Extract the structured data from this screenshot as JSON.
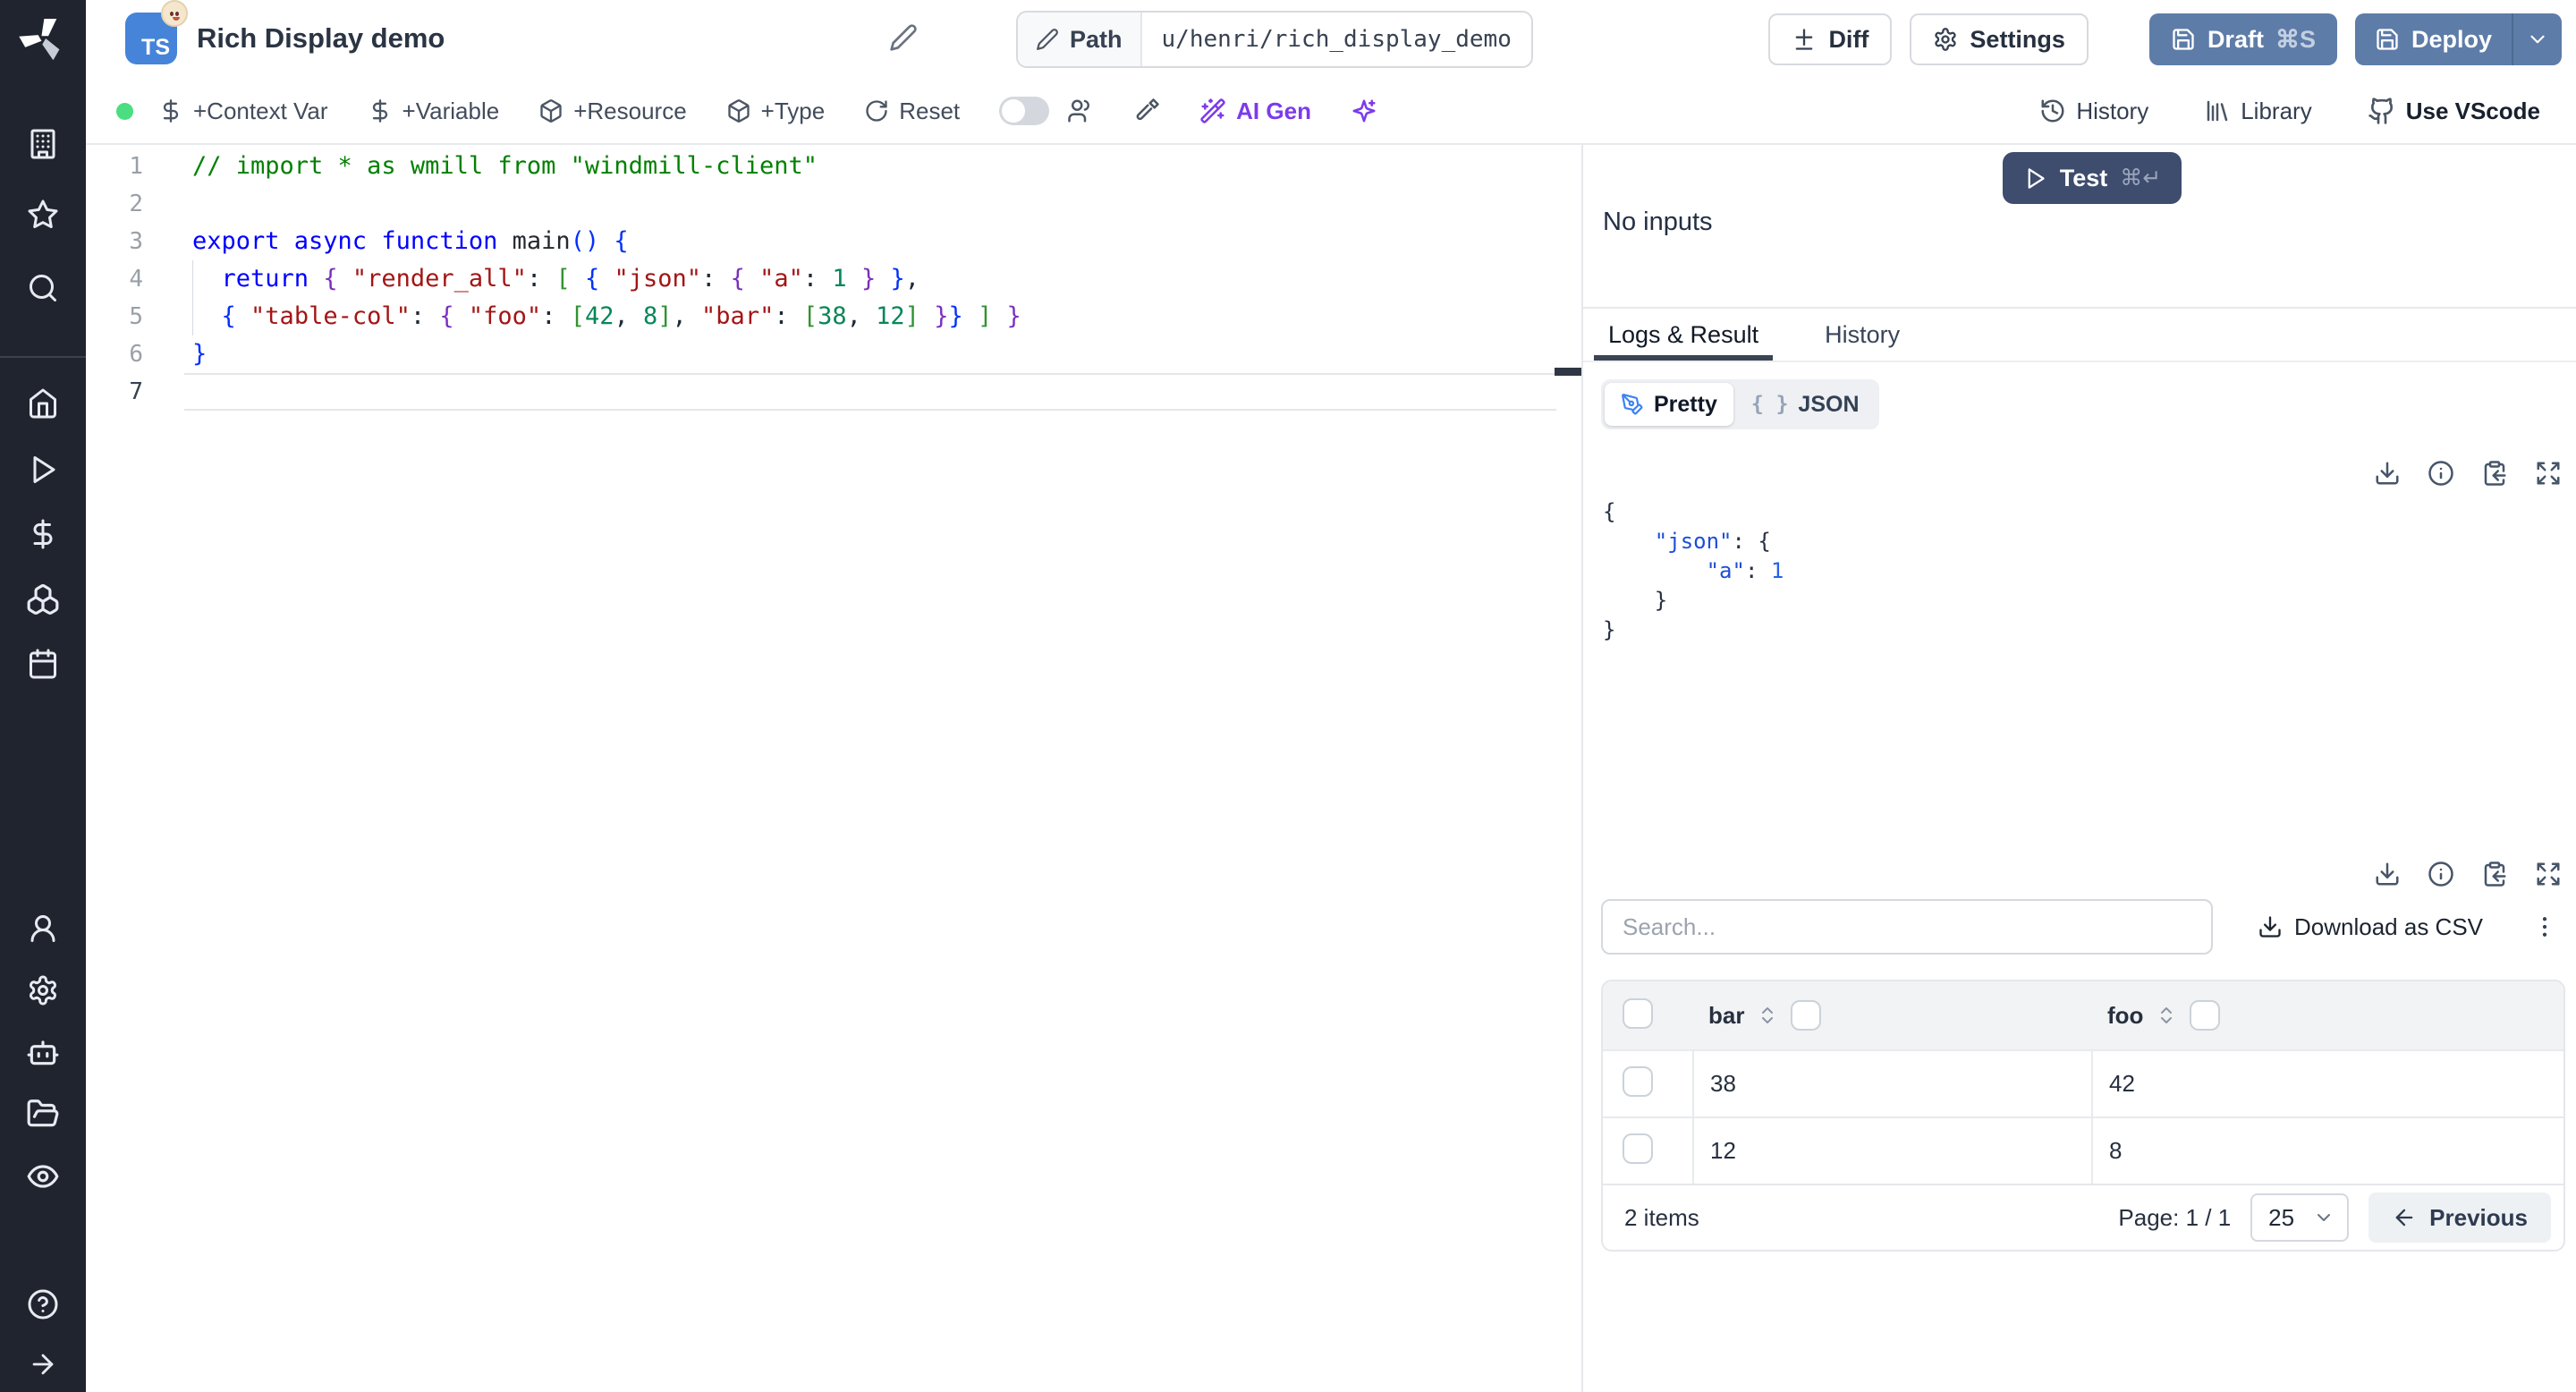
{
  "app": {
    "title": "Rich Display demo"
  },
  "header": {
    "path_label": "Path",
    "path_value": "u/henri/rich_display_demo",
    "buttons": {
      "diff": "Diff",
      "settings": "Settings",
      "draft": "Draft",
      "draft_shortcut": "⌘S",
      "deploy": "Deploy"
    }
  },
  "toolbar": {
    "context_var": "+Context Var",
    "variable": "+Variable",
    "resource": "+Resource",
    "type": "+Type",
    "reset": "Reset",
    "ai_gen": "AI Gen",
    "history": "History",
    "library": "Library",
    "use_vscode": "Use VScode"
  },
  "sidebar": {
    "icons": [
      "windmill-logo",
      "building",
      "star",
      "search",
      "home",
      "play",
      "dollar",
      "boxes",
      "calendar",
      "user",
      "settings",
      "bot",
      "folder-open",
      "eye",
      "help-circle",
      "arrow-right"
    ]
  },
  "editor": {
    "language": "TS",
    "active_line": 7,
    "lines": [
      {
        "num": 1,
        "tokens": [
          {
            "c": "comment",
            "t": "// import * as wmill from \"windmill-client\""
          }
        ]
      },
      {
        "num": 2,
        "tokens": []
      },
      {
        "num": 3,
        "tokens": [
          {
            "c": "keyword",
            "t": "export async function "
          },
          {
            "c": "fn",
            "t": "main"
          },
          {
            "c": "b1",
            "t": "() {"
          }
        ]
      },
      {
        "num": 4,
        "guide": true,
        "tokens": [
          {
            "c": "plain",
            "t": "  "
          },
          {
            "c": "keyword",
            "t": "return"
          },
          {
            "c": "plain",
            "t": " "
          },
          {
            "c": "b2",
            "t": "{"
          },
          {
            "c": "plain",
            "t": " "
          },
          {
            "c": "string",
            "t": "\"render_all\""
          },
          {
            "c": "plain",
            "t": ": "
          },
          {
            "c": "b3",
            "t": "["
          },
          {
            "c": "plain",
            "t": " "
          },
          {
            "c": "b1",
            "t": "{"
          },
          {
            "c": "plain",
            "t": " "
          },
          {
            "c": "string",
            "t": "\"json\""
          },
          {
            "c": "plain",
            "t": ": "
          },
          {
            "c": "b2",
            "t": "{"
          },
          {
            "c": "plain",
            "t": " "
          },
          {
            "c": "string",
            "t": "\"a\""
          },
          {
            "c": "plain",
            "t": ": "
          },
          {
            "c": "number",
            "t": "1"
          },
          {
            "c": "plain",
            "t": " "
          },
          {
            "c": "b2",
            "t": "}"
          },
          {
            "c": "plain",
            "t": " "
          },
          {
            "c": "b1",
            "t": "}"
          },
          {
            "c": "plain",
            "t": ","
          }
        ]
      },
      {
        "num": 5,
        "guide": true,
        "tokens": [
          {
            "c": "plain",
            "t": "  "
          },
          {
            "c": "b1",
            "t": "{"
          },
          {
            "c": "plain",
            "t": " "
          },
          {
            "c": "string",
            "t": "\"table-col\""
          },
          {
            "c": "plain",
            "t": ": "
          },
          {
            "c": "b2",
            "t": "{"
          },
          {
            "c": "plain",
            "t": " "
          },
          {
            "c": "string",
            "t": "\"foo\""
          },
          {
            "c": "plain",
            "t": ": "
          },
          {
            "c": "b3",
            "t": "["
          },
          {
            "c": "number",
            "t": "42"
          },
          {
            "c": "plain",
            "t": ", "
          },
          {
            "c": "number",
            "t": "8"
          },
          {
            "c": "b3",
            "t": "]"
          },
          {
            "c": "plain",
            "t": ", "
          },
          {
            "c": "string",
            "t": "\"bar\""
          },
          {
            "c": "plain",
            "t": ": "
          },
          {
            "c": "b3",
            "t": "["
          },
          {
            "c": "number",
            "t": "38"
          },
          {
            "c": "plain",
            "t": ", "
          },
          {
            "c": "number",
            "t": "12"
          },
          {
            "c": "b3",
            "t": "]"
          },
          {
            "c": "plain",
            "t": " "
          },
          {
            "c": "b2",
            "t": "}"
          },
          {
            "c": "b1",
            "t": "}"
          },
          {
            "c": "plain",
            "t": " "
          },
          {
            "c": "b3",
            "t": "]"
          },
          {
            "c": "plain",
            "t": " "
          },
          {
            "c": "b2",
            "t": "}"
          }
        ]
      },
      {
        "num": 6,
        "tokens": [
          {
            "c": "b1",
            "t": "}"
          }
        ]
      },
      {
        "num": 7,
        "tokens": []
      }
    ]
  },
  "run_panel": {
    "test": "Test",
    "test_shortcut": "⌘↵",
    "no_inputs": "No inputs"
  },
  "result_panel": {
    "tab_logs": "Logs & Result",
    "tab_history": "History",
    "view_pretty": "Pretty",
    "view_json": "JSON",
    "braces_glyph": "{ }",
    "json_lines": [
      {
        "tokens": [
          {
            "c": "jp",
            "t": "{"
          }
        ]
      },
      {
        "tokens": [
          {
            "c": "jp",
            "t": "    "
          },
          {
            "c": "jk",
            "t": "\"json\""
          },
          {
            "c": "jp",
            "t": ": {"
          }
        ]
      },
      {
        "tokens": [
          {
            "c": "jp",
            "t": "        "
          },
          {
            "c": "jk",
            "t": "\"a\""
          },
          {
            "c": "jp",
            "t": ": "
          },
          {
            "c": "jn",
            "t": "1"
          }
        ]
      },
      {
        "tokens": [
          {
            "c": "jp",
            "t": "    }"
          }
        ]
      },
      {
        "tokens": [
          {
            "c": "jp",
            "t": "}"
          }
        ]
      }
    ]
  },
  "table": {
    "search_placeholder": "Search...",
    "download_csv": "Download as CSV",
    "columns": [
      "bar",
      "foo"
    ],
    "rows": [
      {
        "bar": "38",
        "foo": "42"
      },
      {
        "bar": "12",
        "foo": "8"
      }
    ],
    "items_label": "2 items",
    "page_label": "Page: 1 / 1",
    "page_size": "25",
    "previous": "Previous"
  },
  "colors": {
    "accent_slate": "#5e7ca8",
    "test_navy": "#3e4c6e",
    "ai_purple": "#7c3aed",
    "green_dot": "#4ade80",
    "ts_blue": "#4584d9",
    "sidebar_bg": "#20242e"
  }
}
